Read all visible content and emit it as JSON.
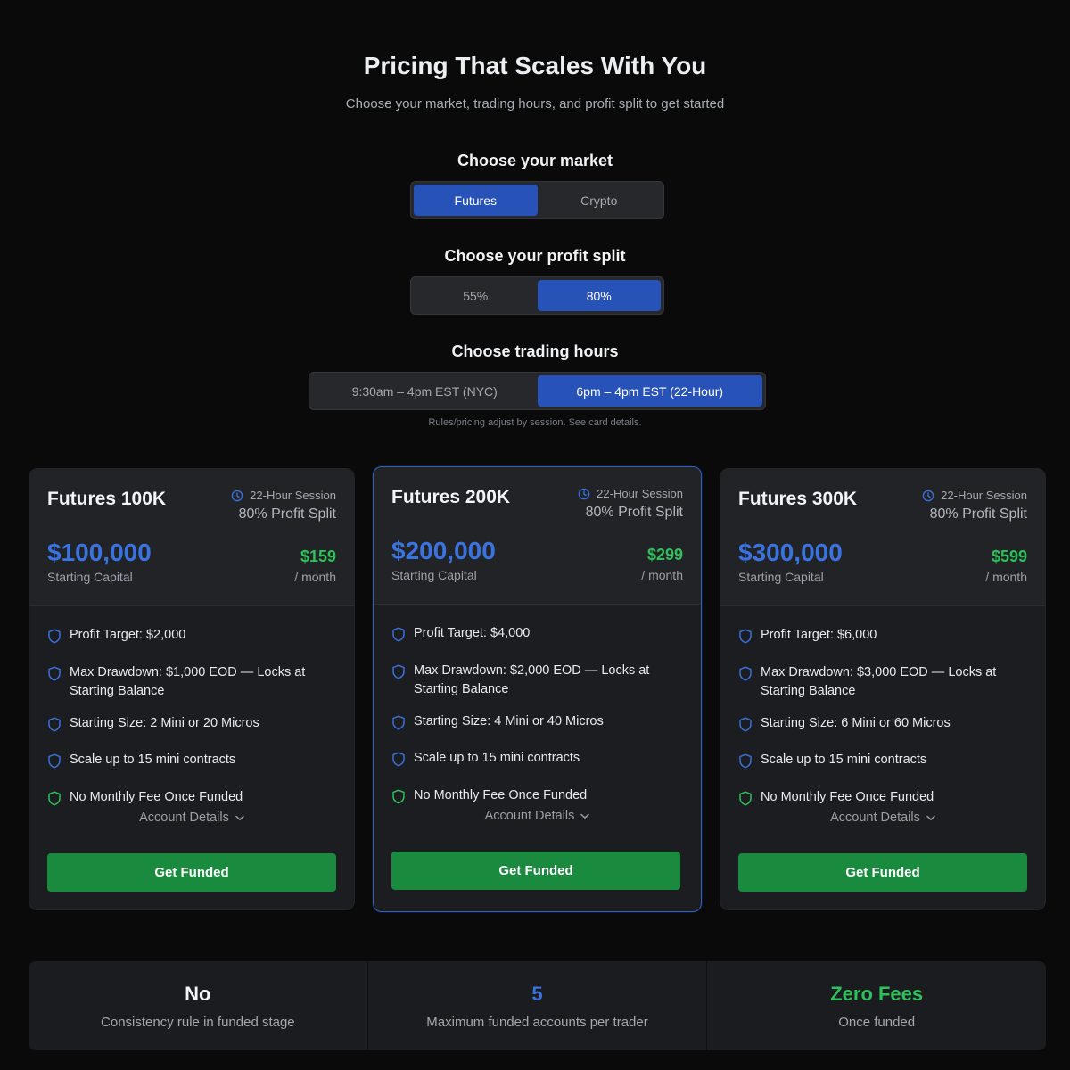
{
  "header": {
    "title": "Pricing That Scales With You",
    "subtitle": "Choose your market, trading hours, and profit split to get started"
  },
  "market": {
    "label": "Choose your market",
    "options": [
      "Futures",
      "Crypto"
    ],
    "selected": "Futures"
  },
  "split": {
    "label": "Choose your profit split",
    "options": [
      "55%",
      "80%"
    ],
    "selected": "80%"
  },
  "hours": {
    "label": "Choose trading hours",
    "options": [
      "9:30am – 4pm EST (NYC)",
      "6pm – 4pm EST (22-Hour)"
    ],
    "selected": "6pm – 4pm EST (22-Hour)",
    "hint": "Rules/pricing adjust by session. See card details."
  },
  "cards": [
    {
      "name": "Futures 100K",
      "session": "22-Hour Session",
      "split": "80% Profit Split",
      "capital": "$100,000",
      "capital_label": "Starting Capital",
      "price": "$159",
      "period": "/ month",
      "features": [
        "Profit Target: $2,000",
        "Max Drawdown: $1,000 EOD — Locks at Starting Balance",
        "Starting Size: 2 Mini or 20 Micros",
        "Scale up to 15 mini contracts",
        "No Monthly Fee Once Funded"
      ],
      "details": "Account Details",
      "cta": "Get Funded"
    },
    {
      "name": "Futures 200K",
      "session": "22-Hour Session",
      "split": "80% Profit Split",
      "capital": "$200,000",
      "capital_label": "Starting Capital",
      "price": "$299",
      "period": "/ month",
      "features": [
        "Profit Target: $4,000",
        "Max Drawdown: $2,000 EOD — Locks at Starting Balance",
        "Starting Size: 4 Mini or 40 Micros",
        "Scale up to 15 mini contracts",
        "No Monthly Fee Once Funded"
      ],
      "details": "Account Details",
      "cta": "Get Funded"
    },
    {
      "name": "Futures 300K",
      "session": "22-Hour Session",
      "split": "80% Profit Split",
      "capital": "$300,000",
      "capital_label": "Starting Capital",
      "price": "$599",
      "period": "/ month",
      "features": [
        "Profit Target: $6,000",
        "Max Drawdown: $3,000 EOD — Locks at Starting Balance",
        "Starting Size: 6 Mini or 60 Micros",
        "Scale up to 15 mini contracts",
        "No Monthly Fee Once Funded"
      ],
      "details": "Account Details",
      "cta": "Get Funded"
    }
  ],
  "stats": [
    {
      "value": "No",
      "desc": "Consistency rule in funded stage",
      "color": "#f3f4f6"
    },
    {
      "value": "5",
      "desc": "Maximum funded accounts per trader",
      "color": "#3a73e0"
    },
    {
      "value": "Zero Fees",
      "desc": "Once funded",
      "color": "#2fbf5b"
    }
  ],
  "colors": {
    "accent_blue": "#2752b7",
    "capital_blue": "#3a73e0",
    "price_green": "#2fbf5b",
    "cta_green": "#1a8a3e",
    "shield_blue": "#3a6fd8",
    "shield_green": "#2fbf5b"
  },
  "icons": {
    "session": "clock-icon",
    "feature": "shield-icon",
    "feature_last": "shield-check-icon",
    "details": "chevron-down-icon"
  }
}
